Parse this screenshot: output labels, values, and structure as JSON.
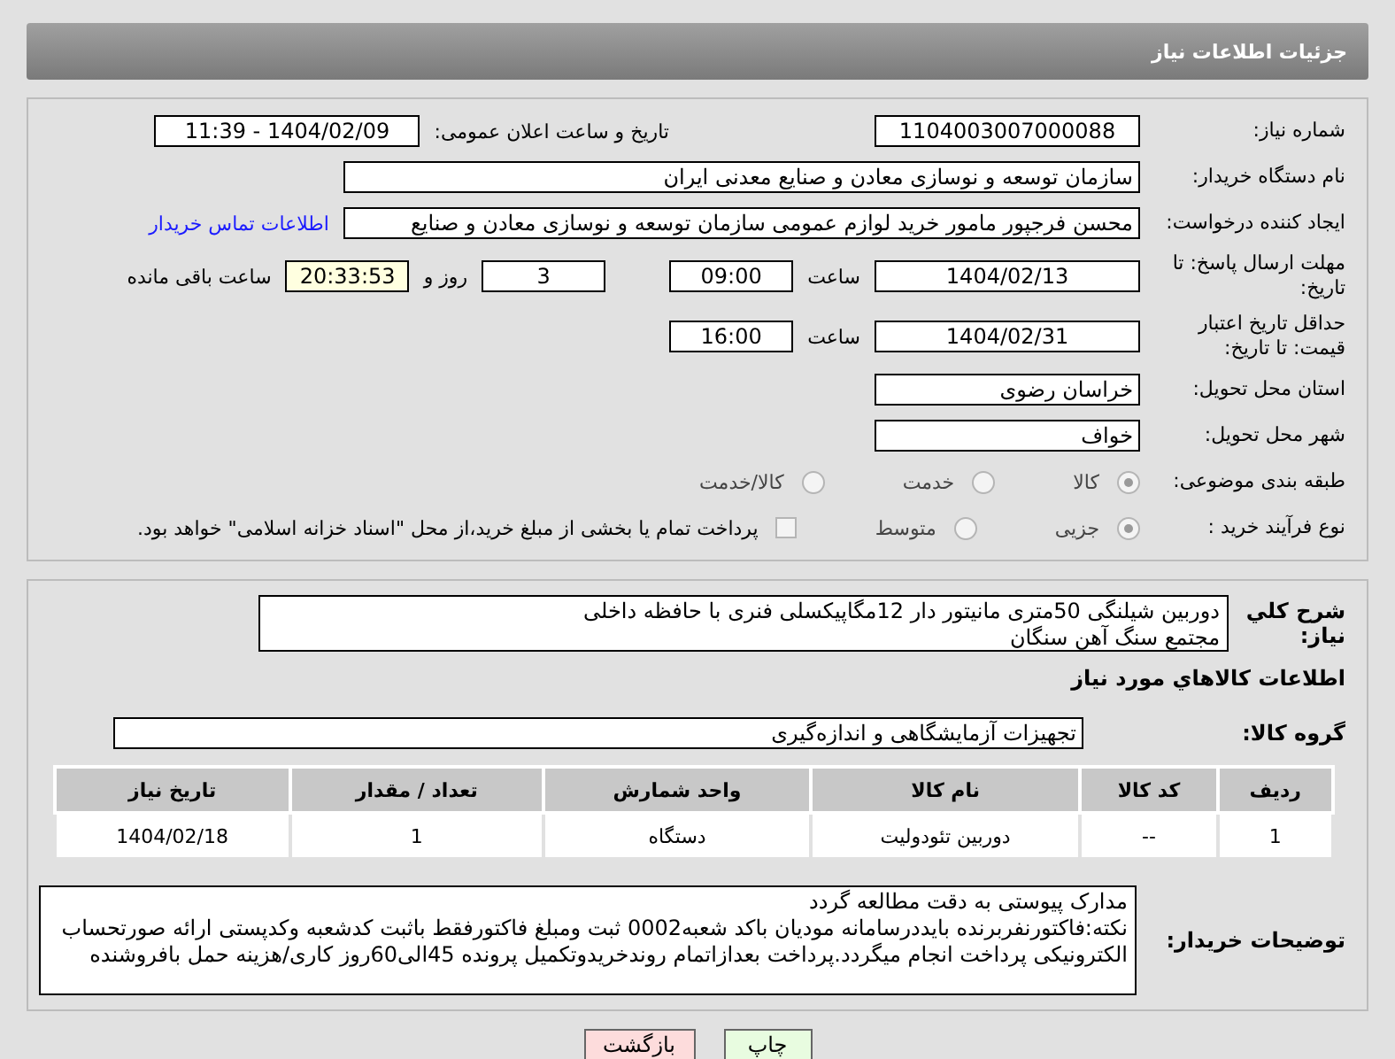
{
  "header": {
    "title": "جزئیات اطلاعات نیاز"
  },
  "need_number": {
    "label": "شماره نیاز:",
    "value": "1104003007000088"
  },
  "announce": {
    "label": "تاریخ و ساعت اعلان عمومی:",
    "value": "1404/02/09 - 11:39"
  },
  "buyer_org": {
    "label": "نام دستگاه خریدار:",
    "value": "سازمان توسعه و نوسازی معادن و صنایع معدنی ایران"
  },
  "creator": {
    "label": "ایجاد کننده درخواست:",
    "value": "محسن فرجپور مامور خرید لوازم عمومی سازمان توسعه و نوسازی معادن و صنایع",
    "link": "اطلاعات تماس خریدار"
  },
  "deadline": {
    "label": "مهلت ارسال پاسخ: تا تاریخ:",
    "date": "1404/02/13",
    "time_label": "ساعت",
    "time": "09:00",
    "days": "3",
    "days_label": "روز و",
    "remaining": "20:33:53",
    "remaining_label": "ساعت باقی مانده"
  },
  "validity": {
    "label": "حداقل تاریخ اعتبار قیمت: تا تاریخ:",
    "date": "1404/02/31",
    "time_label": "ساعت",
    "time": "16:00"
  },
  "province": {
    "label": "استان محل تحویل:",
    "value": "خراسان رضوی"
  },
  "city": {
    "label": "شهر محل تحویل:",
    "value": "خواف"
  },
  "category": {
    "label": "طبقه بندی موضوعی:",
    "options": [
      {
        "label": "کالا",
        "selected": true
      },
      {
        "label": "خدمت",
        "selected": false
      },
      {
        "label": "کالا/خدمت",
        "selected": false
      }
    ]
  },
  "process": {
    "label": "نوع فرآیند خرید :",
    "options": [
      {
        "label": "جزیی",
        "selected": true
      },
      {
        "label": "متوسط",
        "selected": false
      }
    ],
    "treasury": {
      "checked": false,
      "label": "پرداخت تمام یا بخشی از مبلغ خرید،از محل \"اسناد خزانه اسلامی\" خواهد بود."
    }
  },
  "description": {
    "label": "شرح کلي نياز:",
    "lines": [
      "دوربین شیلنگی 50متری مانیتور دار 12مگاپیکسلی فنری با حافظه داخلی",
      "مجتمع سنگ آهن سنگان"
    ]
  },
  "goods_title": "اطلاعات کالاهاي مورد نياز",
  "goods_group": {
    "label": "گروه کالا:",
    "value": "تجهیزات آزمایشگاهی و اندازه‌گیری"
  },
  "table": {
    "columns": [
      "ردیف",
      "کد کالا",
      "نام کالا",
      "واحد شمارش",
      "تعداد / مقدار",
      "تاریخ نیاز"
    ],
    "rows": [
      [
        "1",
        "--",
        "دوربین تئودولیت",
        "دستگاه",
        "1",
        "1404/02/18"
      ]
    ]
  },
  "buyer_notes": {
    "label": "توضیحات خریدار:",
    "lines": [
      "مدارک پیوستی به دقت مطالعه گردد",
      "نکته:فاکتورنفربرنده بایددرسامانه مودیان باکد شعبه0002 ثبت ومبلغ فاکتورفقط باثبت کدشعبه وکدپستی ارائه صورتحساب",
      "الکترونیکی پرداخت انجام میگردد.پرداخت بعدازاتمام روندخریدوتکمیل پرونده 45الی60روز کاری/هزینه حمل بافروشنده"
    ]
  },
  "buttons": [
    {
      "label": "چاپ",
      "color": "#e8fce0"
    },
    {
      "label": "بازگشت",
      "color": "#fddcdc"
    }
  ]
}
